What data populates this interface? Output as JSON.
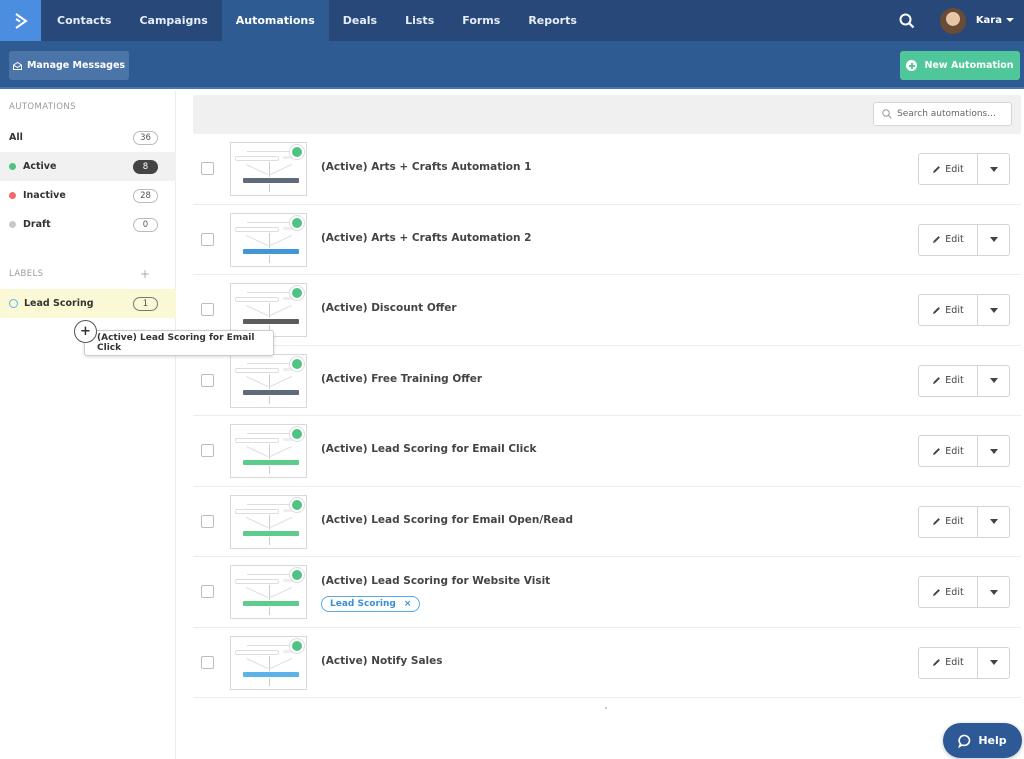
{
  "nav": {
    "logo": "activecampaign-logo",
    "items": [
      {
        "label": "Contacts",
        "active": false
      },
      {
        "label": "Campaigns",
        "active": false
      },
      {
        "label": "Automations",
        "active": true
      },
      {
        "label": "Deals",
        "active": false
      },
      {
        "label": "Lists",
        "active": false
      },
      {
        "label": "Forms",
        "active": false
      },
      {
        "label": "Reports",
        "active": false
      }
    ],
    "search_icon": "search-icon",
    "user_name": "Kara"
  },
  "subbar": {
    "manage_messages_label": "Manage Messages",
    "new_automation_label": "New Automation"
  },
  "sidebar": {
    "automations_heading": "AUTOMATIONS",
    "filters": [
      {
        "label": "All",
        "count": "36",
        "dot_color": null,
        "selected": false
      },
      {
        "label": "Active",
        "count": "8",
        "dot_color": "#4fc384",
        "selected": true
      },
      {
        "label": "Inactive",
        "count": "28",
        "dot_color": "#f06a6a",
        "selected": false
      },
      {
        "label": "Draft",
        "count": "0",
        "dot_color": "#c8c8c8",
        "selected": false
      }
    ],
    "labels_heading": "LABELS",
    "labels_add": "+",
    "labels": [
      {
        "label": "Lead Scoring",
        "count": "1"
      }
    ]
  },
  "drag_tooltip": {
    "text": "(Active) Lead Scoring for Email Click",
    "handle": "+"
  },
  "main": {
    "search_placeholder": "Search automations...",
    "edit_label": "Edit",
    "rows": [
      {
        "title": "(Active) Arts + Crafts Automation 1",
        "thumb_bar_color": "#5f6b7a",
        "tag": null
      },
      {
        "title": "(Active) Arts + Crafts Automation 2",
        "thumb_bar_color": "#3f97d8",
        "tag": null
      },
      {
        "title": "(Active) Discount Offer",
        "thumb_bar_color": "#5c5c5c",
        "tag": null
      },
      {
        "title": "(Active) Free Training Offer",
        "thumb_bar_color": "#5f6b7a",
        "tag": null
      },
      {
        "title": "(Active) Lead Scoring for Email Click",
        "thumb_bar_color": "#5ccb8c",
        "tag": null
      },
      {
        "title": "(Active) Lead Scoring for Email Open/Read",
        "thumb_bar_color": "#5ccb8c",
        "tag": null
      },
      {
        "title": "(Active) Lead Scoring for Website Visit",
        "thumb_bar_color": "#5ccb8c",
        "tag": "Lead Scoring"
      },
      {
        "title": "(Active) Notify Sales",
        "thumb_bar_color": "#5ab4ea",
        "tag": null
      }
    ]
  },
  "help": {
    "label": "Help"
  },
  "colors": {
    "nav_bg": "#274878",
    "nav_active": "#2f5b93",
    "logo_bg": "#4b8ee0",
    "new_button": "#4fc79a",
    "help_button": "#2d5996",
    "label_highlight": "#fbf9d5"
  }
}
